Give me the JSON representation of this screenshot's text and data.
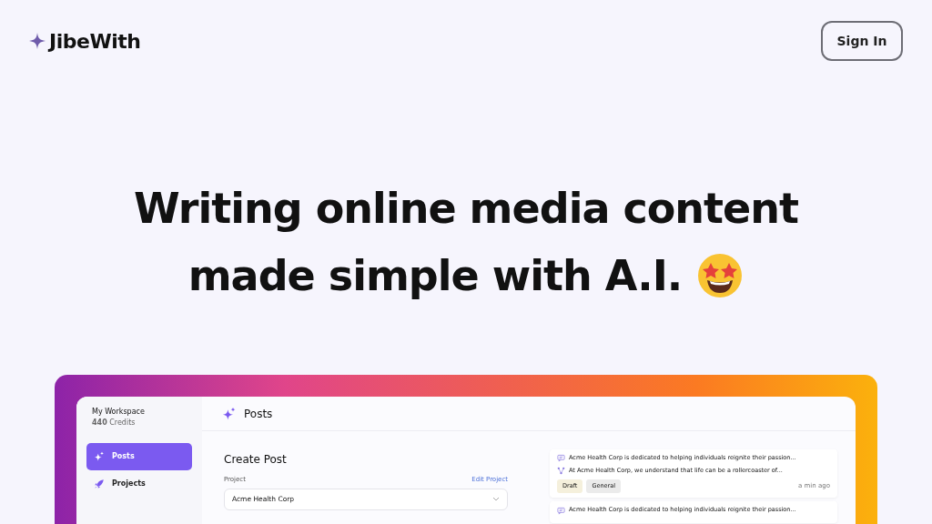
{
  "brand": {
    "name": "JibeWith"
  },
  "sign_in": {
    "label": "Sign In"
  },
  "headline": {
    "lines": [
      "Writing online media content",
      "made simple with A.I."
    ]
  },
  "app": {
    "workspace": {
      "name": "My Workspace",
      "credits_count": "440",
      "credits_label": "Credits"
    },
    "sidebar": {
      "items": [
        {
          "label": "Posts",
          "kind": "sparkle",
          "selected": true
        },
        {
          "label": "Projects",
          "kind": "rocket",
          "selected": false
        }
      ]
    },
    "page_title": "Posts",
    "create_post": {
      "title": "Create Post",
      "project_label": "Project",
      "edit_link": "Edit Project",
      "project_value": "Acme Health Corp"
    },
    "posts": [
      {
        "lines": [
          {
            "kind": "chat",
            "text": "Acme Health Corp is dedicated to helping individuals reignite their passion..."
          },
          {
            "kind": "network",
            "text": "At Acme Health Corp, we understand that life can be a rollercoaster of..."
          }
        ],
        "tags": [
          {
            "label": "Draft",
            "color": "#f5f0dc"
          },
          {
            "label": "General",
            "color": "#ebebeb"
          }
        ],
        "time": "a min ago"
      },
      {
        "lines": [
          {
            "kind": "chat",
            "text": "Acme Health Corp is dedicated to helping individuals reignite their passion..."
          }
        ]
      }
    ]
  }
}
